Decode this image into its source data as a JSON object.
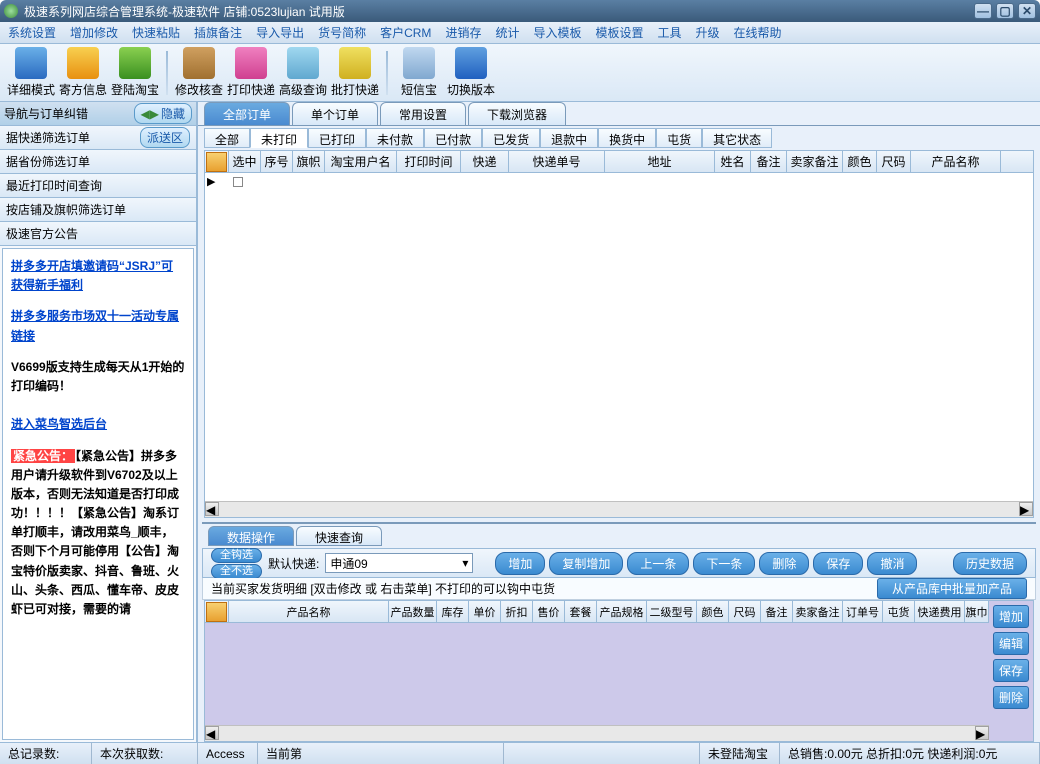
{
  "title": "极速系列网店综合管理系统-极速软件 店铺:0523lujian 试用版",
  "menu": [
    "系统设置",
    "增加修改",
    "快速粘贴",
    "插旗备注",
    "导入导出",
    "货号简称",
    "客户CRM",
    "进销存",
    "统计",
    "导入模板",
    "模板设置",
    "工具",
    "升级",
    "在线帮助"
  ],
  "toolbar": [
    {
      "label": "详细模式",
      "color": "linear-gradient(#6ab0e8,#2a6ac0)"
    },
    {
      "label": "寄方信息",
      "color": "linear-gradient(#f8d050,#e89010)"
    },
    {
      "label": "登陆淘宝",
      "color": "linear-gradient(#8ad050,#3a9020)"
    },
    {
      "sep": true
    },
    {
      "label": "修改核查",
      "color": "linear-gradient(#d0a060,#a07030)"
    },
    {
      "label": "打印快递",
      "color": "linear-gradient(#f080c0,#d04090)"
    },
    {
      "label": "高级查询",
      "color": "linear-gradient(#a0d8f0,#60a8d0)"
    },
    {
      "label": "批打快递",
      "color": "linear-gradient(#f0e060,#d0b020)"
    },
    {
      "sep": true
    },
    {
      "label": "短信宝",
      "color": "linear-gradient(#c0d8f0,#80a8d0)"
    },
    {
      "label": "切换版本",
      "color": "linear-gradient(#60a0e0,#2060c0)"
    }
  ],
  "nav": {
    "header": "导航与订单纠错",
    "hide": "隐藏",
    "items": [
      {
        "label": "据快递筛选订单",
        "btn": "派送区"
      },
      {
        "label": "据省份筛选订单"
      },
      {
        "label": "最近打印时间查询"
      },
      {
        "label": "按店铺及旗帜筛选订单"
      },
      {
        "label": "极速官方公告"
      }
    ]
  },
  "notices": {
    "link1": "拼多多开店填邀请码“JSRJ”可获得新手福利",
    "link2": "拼多多服务市场双十一活动专属链接",
    "text1": "V6699版支持生成每天从1开始的打印编码！",
    "link3": "进入菜鸟智选后台",
    "urgent_label": "紧急公告：",
    "urgent_text": "【紧急公告】拼多多用户请升级软件到V6702及以上版本，否则无法知道是否打印成功！！！！【紧急公告】淘系订单打顺丰，请改用菜鸟_顺丰，否则下个月可能停用【公告】淘宝特价版卖家、抖音、鲁班、火山、头条、西瓜、懂车帝、皮皮虾已可对接，需要的请"
  },
  "maintabs": [
    "全部订单",
    "单个订单",
    "常用设置",
    "下载浏览器"
  ],
  "subtabs": [
    "全部",
    "未打印",
    "已打印",
    "未付款",
    "已付款",
    "已发货",
    "退款中",
    "换货中",
    "屯货",
    "其它状态"
  ],
  "gridcols": [
    {
      "label": "",
      "w": 24,
      "icon": true
    },
    {
      "label": "选中",
      "w": 32
    },
    {
      "label": "序号",
      "w": 32
    },
    {
      "label": "旗帜",
      "w": 32
    },
    {
      "label": "淘宝用户名",
      "w": 72
    },
    {
      "label": "打印时间",
      "w": 64
    },
    {
      "label": "快递",
      "w": 48
    },
    {
      "label": "快递单号",
      "w": 96
    },
    {
      "label": "地址",
      "w": 110
    },
    {
      "label": "姓名",
      "w": 36
    },
    {
      "label": "备注",
      "w": 36
    },
    {
      "label": "卖家备注",
      "w": 56
    },
    {
      "label": "颜色",
      "w": 34
    },
    {
      "label": "尺码",
      "w": 34
    },
    {
      "label": "产品名称",
      "w": 90
    }
  ],
  "bottabs": [
    "数据操作",
    "快速查询"
  ],
  "ops": {
    "selall": "全钩选",
    "selnone": "全不选",
    "defexp_label": "默认快递:",
    "defexp_value": "申通09",
    "buttons": [
      "增加",
      "复制增加",
      "上一条",
      "下一条",
      "删除",
      "保存",
      "撤消"
    ],
    "history": "历史数据"
  },
  "inforow": {
    "text": "当前买家发货明细 [双击修改 或 右击菜单] 不打印的可以钩中屯货",
    "btn": "从产品库中批量加产品"
  },
  "detailcols": [
    {
      "label": "",
      "w": 24,
      "icon": true
    },
    {
      "label": "产品名称",
      "w": 160
    },
    {
      "label": "产品数量",
      "w": 48
    },
    {
      "label": "库存",
      "w": 32
    },
    {
      "label": "单价",
      "w": 32
    },
    {
      "label": "折扣",
      "w": 32
    },
    {
      "label": "售价",
      "w": 32
    },
    {
      "label": "套餐",
      "w": 32
    },
    {
      "label": "产品规格",
      "w": 50
    },
    {
      "label": "二级型号",
      "w": 50
    },
    {
      "label": "颜色",
      "w": 32
    },
    {
      "label": "尺码",
      "w": 32
    },
    {
      "label": "备注",
      "w": 32
    },
    {
      "label": "卖家备注",
      "w": 50
    },
    {
      "label": "订单号",
      "w": 40
    },
    {
      "label": "屯货",
      "w": 32
    },
    {
      "label": "快递费用",
      "w": 50
    },
    {
      "label": "旗巾",
      "w": 24
    }
  ],
  "sidebtns": [
    "增加",
    "编辑",
    "保存",
    "删除"
  ],
  "status": {
    "records": "总记录数:",
    "fetch": "本次获取数:",
    "access": "Access",
    "curpage": "当前第",
    "notlogin": "未登陆淘宝",
    "totals": "总销售:0.00元 总折扣:0元 快递利润:0元"
  }
}
